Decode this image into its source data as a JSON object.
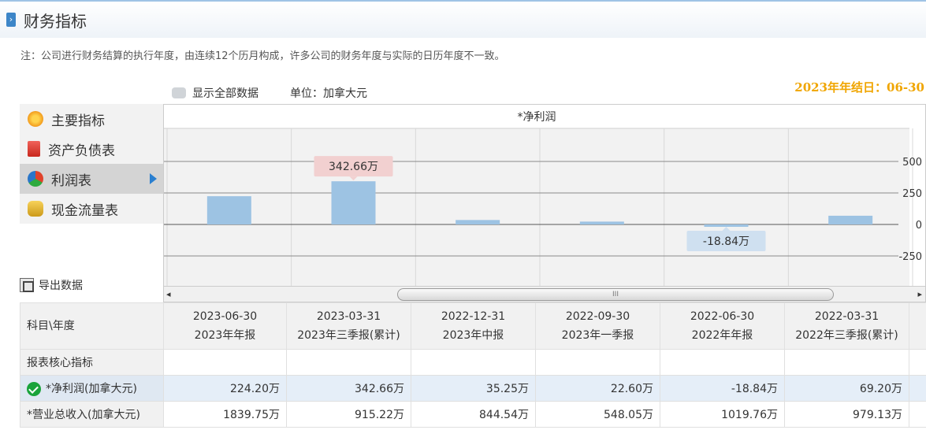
{
  "header": {
    "title": "财务指标",
    "marker": "›"
  },
  "note": "注：公司进行财务结算的执行年度，由连续12个历月构成，许多公司的财务年度与实际的日历年度不一致。",
  "toolbar": {
    "show_all_label": "显示全部数据",
    "unit_label": "单位：加拿大元",
    "fiscal_year_end": "2023年年结日：06-30"
  },
  "sidebar": {
    "items": [
      {
        "label": "主要指标",
        "icon": "flower-icon",
        "active": false
      },
      {
        "label": "资产负债表",
        "icon": "document-icon",
        "active": false
      },
      {
        "label": "利润表",
        "icon": "pie-chart-icon",
        "active": true
      },
      {
        "label": "现金流量表",
        "icon": "coins-icon",
        "active": false
      }
    ]
  },
  "export_label": "导出数据",
  "chart_data": {
    "type": "bar",
    "title": "*净利润",
    "categories": [
      "2023-06-30",
      "2023-03-31",
      "2022-12-31",
      "2022-09-30",
      "2022-06-30",
      "2022-03-31"
    ],
    "values": [
      224.2,
      342.66,
      35.25,
      22.6,
      -18.84,
      69.2
    ],
    "y_ticks": [
      500,
      250,
      0,
      -250
    ],
    "tooltips": [
      {
        "index": 1,
        "label": "342.66万"
      },
      {
        "index": 4,
        "label": "-18.84万"
      }
    ],
    "colors": {
      "bar": "#9dc3e3",
      "tooltip_pos": "#f2d0d0",
      "tooltip_neg": "#cfe0f0"
    }
  },
  "scrollbar": {
    "left": "◂",
    "right": "▸",
    "grip": "III"
  },
  "table": {
    "corner": "科目\\年度",
    "columns": [
      {
        "date": "2023-06-30",
        "period": "2023年年报"
      },
      {
        "date": "2023-03-31",
        "period": "2023年三季报(累计)"
      },
      {
        "date": "2022-12-31",
        "period": "2023年中报"
      },
      {
        "date": "2022-09-30",
        "period": "2023年一季报"
      },
      {
        "date": "2022-06-30",
        "period": "2022年年报"
      },
      {
        "date": "2022-03-31",
        "period": "2022年三季报(累计)"
      }
    ],
    "section_label": "报表核心指标",
    "rows": [
      {
        "label": "*净利润(加拿大元)",
        "values": [
          "224.20万",
          "342.66万",
          "35.25万",
          "22.60万",
          "-18.84万",
          "69.20万"
        ]
      },
      {
        "label": "*营业总收入(加拿大元)",
        "values": [
          "1839.75万",
          "915.22万",
          "844.54万",
          "548.05万",
          "1019.76万",
          "979.13万"
        ]
      }
    ]
  }
}
